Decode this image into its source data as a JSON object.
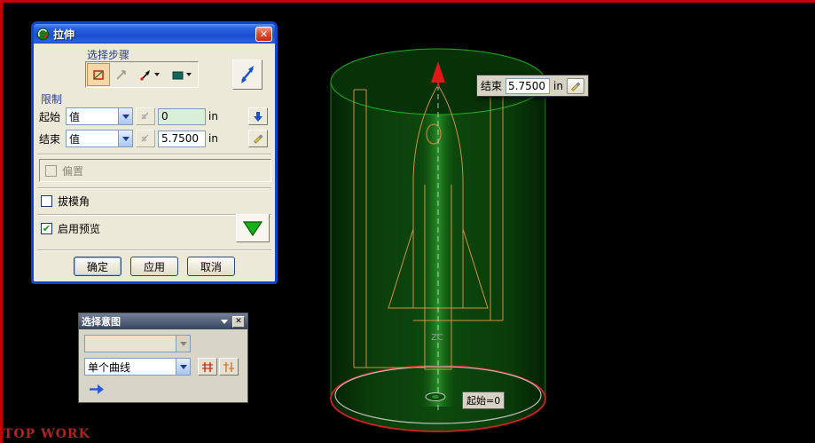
{
  "colors": {
    "cyl_edge_green": "#1fae1f",
    "sketch_orange": "#d2913f",
    "arrow_red": "#e01818",
    "bottom_red": "#d42020",
    "datum_gray": "#b8bcb8"
  },
  "extrude_dialog": {
    "title": "拉伸",
    "close_glyph": "✕",
    "select_steps_label": "选择步骤",
    "limits_label": "限制",
    "start": {
      "label": "起始",
      "mode": "值",
      "value": "0",
      "unit": "in"
    },
    "end": {
      "label": "结束",
      "mode": "值",
      "value": "5.7500",
      "unit": "in"
    },
    "offset_label": "偏置",
    "draft_label": "拔模角",
    "preview_label": "启用预览",
    "preview_checked_glyph": "✔",
    "ok_label": "确定",
    "apply_label": "应用",
    "cancel_label": "取消"
  },
  "intent_dialog": {
    "title": "选择意图",
    "close_glyph": "✕",
    "curve_mode_value": "单个曲线"
  },
  "viewport": {
    "end_tag_label": "结束",
    "end_tag_value": "5.7500",
    "end_tag_unit": "in",
    "start_tag": "起始=0",
    "axis_label": "ZC",
    "watermark": "TOP WORK"
  }
}
